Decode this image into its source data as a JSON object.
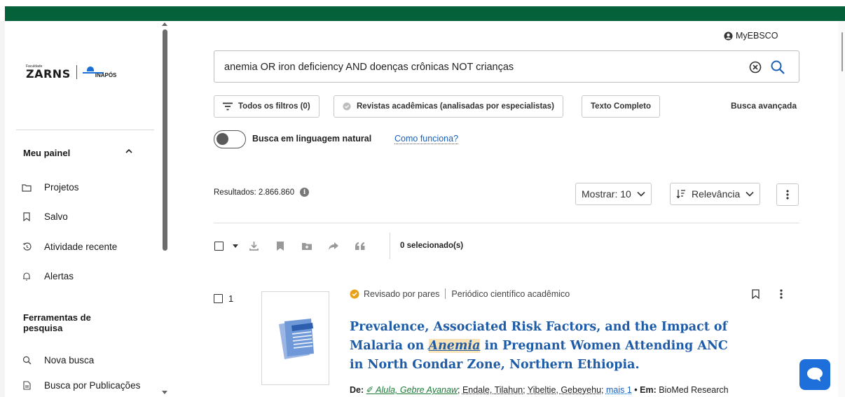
{
  "brand": {
    "small_text": "Faculdade",
    "name1": "ZARNS",
    "name2": "INAPÓS"
  },
  "sidebar": {
    "section1_title": "Meu painel",
    "items1": [
      {
        "label": "Projetos",
        "icon": "folder-icon"
      },
      {
        "label": "Salvo",
        "icon": "bookmark-icon"
      },
      {
        "label": "Atividade recente",
        "icon": "history-icon"
      },
      {
        "label": "Alertas",
        "icon": "bell-icon"
      }
    ],
    "section2_title": "Ferramentas de pesquisa",
    "items2": [
      {
        "label": "Nova busca",
        "icon": "search-icon"
      },
      {
        "label": "Busca por Publicações",
        "icon": "document-icon"
      }
    ]
  },
  "header": {
    "myebsco": "MyEBSCO"
  },
  "search": {
    "query": "anemia OR iron deficiency AND doenças crônicas NOT crianças"
  },
  "filters": {
    "all_filters": "Todos os filtros (0)",
    "academic": "Revistas acadêmicas (analisadas por especialistas)",
    "full_text": "Texto Completo",
    "advanced": "Busca avançada"
  },
  "natural_language": {
    "label": "Busca em linguagem natural",
    "help_link": "Como funciona?",
    "enabled": false
  },
  "results": {
    "count_label": "Resultados: 2.866.860",
    "show_label": "Mostrar: 10",
    "sort_label": "Relevância",
    "selected_label": "0 selecionado(s)"
  },
  "items": [
    {
      "index": "1",
      "peer_reviewed": "Revisado por pares",
      "type": "Periódico científico acadêmico",
      "title_before": "Prevalence, Associated Risk Factors, and the Impact of Malaria on ",
      "title_highlight": "Anemia",
      "title_after": " in Pregnant Women Attending ANC in North Gondar Zone, Northern Ethiopia.",
      "authors_prefix": "De:",
      "author1": "Alula, Gebre Ayanaw",
      "author2": "Endale, Tilahun",
      "author3": "Yibeltie, Gebeyehu",
      "more": "mais 1",
      "in_prefix": "• Em:",
      "source": "BioMed Research"
    }
  ],
  "colors": {
    "brand_green": "#05613a",
    "link_blue": "#1f5ca8",
    "highlight": "#f9e3b8",
    "chat_blue": "#1e6fd9"
  }
}
